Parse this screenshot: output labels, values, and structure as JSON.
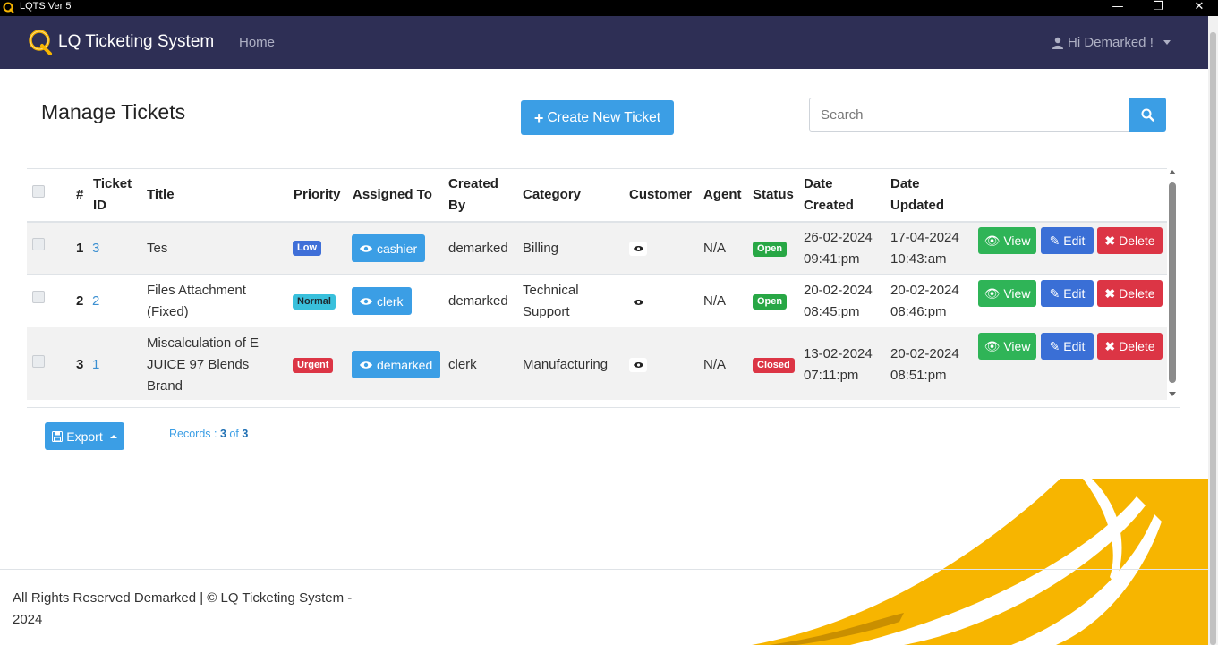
{
  "window": {
    "title": "LQTS Ver 5"
  },
  "navbar": {
    "brand": "LQ Ticketing System",
    "home": "Home",
    "user": "Hi Demarked !"
  },
  "page": {
    "title": "Manage Tickets",
    "create_button": "Create New Ticket",
    "search_placeholder": "Search"
  },
  "table": {
    "headers": {
      "num": "#",
      "ticket_id": [
        "Ticket",
        "ID"
      ],
      "title": "Title",
      "priority": "Priority",
      "assigned_to": "Assigned To",
      "created_by": [
        "Created",
        "By"
      ],
      "category": "Category",
      "customer": "Customer",
      "agent": "Agent",
      "status": "Status",
      "date_created": [
        "Date",
        "Created"
      ],
      "date_updated": [
        "Date",
        "Updated"
      ]
    },
    "rows": [
      {
        "num": "1",
        "ticket_id": "3",
        "title": [
          "Tes"
        ],
        "priority": "Low",
        "assigned_to": "cashier",
        "created_by": "demarked",
        "category": [
          "Billing"
        ],
        "agent": "N/A",
        "status": "Open",
        "date_created": [
          "26-02-2024",
          "09:41:pm"
        ],
        "date_updated": [
          "17-04-2024",
          "10:43:am"
        ]
      },
      {
        "num": "2",
        "ticket_id": "2",
        "title": [
          "Files Attachment",
          "(Fixed)"
        ],
        "priority": "Normal",
        "assigned_to": "clerk",
        "created_by": "demarked",
        "category": [
          "Technical",
          "Support"
        ],
        "agent": "N/A",
        "status": "Open",
        "date_created": [
          "20-02-2024",
          "08:45:pm"
        ],
        "date_updated": [
          "20-02-2024",
          "08:46:pm"
        ]
      },
      {
        "num": "3",
        "ticket_id": "1",
        "title": [
          "Miscalculation of E",
          "JUICE 97 Blends",
          "Brand"
        ],
        "priority": "Urgent",
        "assigned_to": "demarked",
        "created_by": "clerk",
        "category": [
          "Manufacturing"
        ],
        "agent": "N/A",
        "status": "Closed",
        "date_created": [
          "13-02-2024",
          "07:11:pm"
        ],
        "date_updated": [
          "20-02-2024",
          "08:51:pm"
        ]
      }
    ],
    "actions": {
      "view": "View",
      "edit": "Edit",
      "delete": "Delete"
    }
  },
  "footer_controls": {
    "export": "Export",
    "records_label": "Records :",
    "records_shown": "3",
    "records_of": "of",
    "records_total": "3"
  },
  "footer": {
    "text": [
      "All Rights Reserved Demarked | © LQ Ticketing System -",
      "2024"
    ]
  },
  "colors": {
    "navbar": "#2e2f55",
    "primary": "#3b9ee5",
    "success": "#2fb457",
    "danger": "#dc3545",
    "accent_yellow": "#f7b500"
  }
}
